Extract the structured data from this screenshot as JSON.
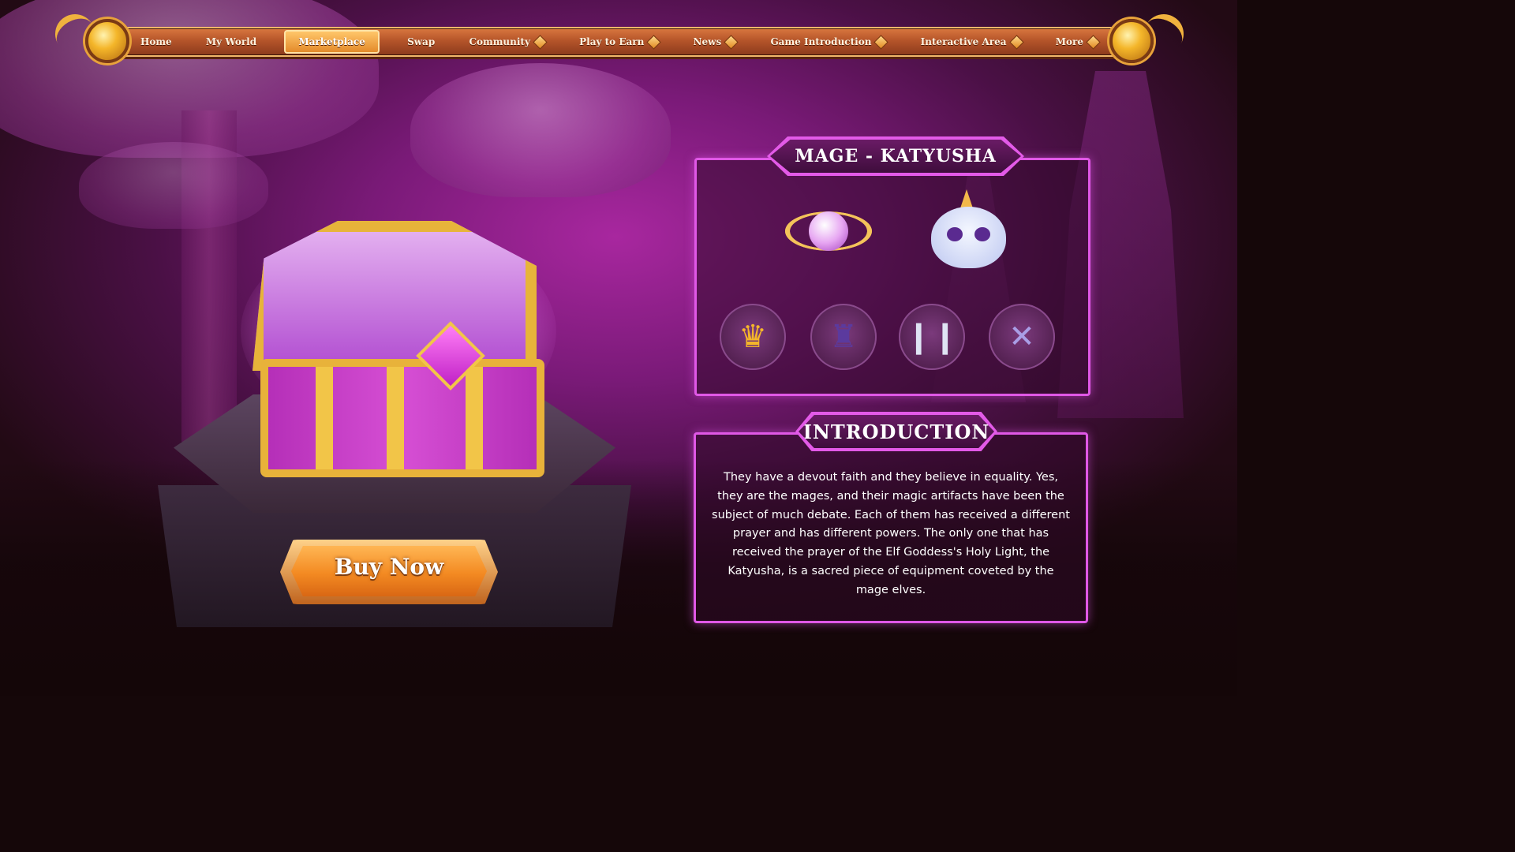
{
  "nav": {
    "items": [
      {
        "label": "Home",
        "active": false,
        "has_gem": false
      },
      {
        "label": "My World",
        "active": false,
        "has_gem": false
      },
      {
        "label": "Marketplace",
        "active": true,
        "has_gem": false
      },
      {
        "label": "Swap",
        "active": false,
        "has_gem": false
      },
      {
        "label": "Community",
        "active": false,
        "has_gem": true
      },
      {
        "label": "Play to Earn",
        "active": false,
        "has_gem": true
      },
      {
        "label": "News",
        "active": false,
        "has_gem": true
      },
      {
        "label": "Game Introduction",
        "active": false,
        "has_gem": true
      },
      {
        "label": "Interactive Area",
        "active": false,
        "has_gem": true
      },
      {
        "label": "More",
        "active": false,
        "has_gem": true
      }
    ]
  },
  "chest": {
    "buy_label": "Buy Now"
  },
  "set_panel": {
    "title": "MAGE - KATYUSHA",
    "items": [
      {
        "name": "orb-artifact-icon",
        "glyph": ""
      },
      {
        "name": "pet-icon",
        "glyph": ""
      },
      {
        "name": "crown-icon",
        "glyph": "♛"
      },
      {
        "name": "robe-icon",
        "glyph": "♜"
      },
      {
        "name": "boots-icon",
        "glyph": "❙❙"
      },
      {
        "name": "wings-icon",
        "glyph": "✕"
      }
    ]
  },
  "intro_panel": {
    "title": "INTRODUCTION",
    "text": "They have a devout faith and they believe in equality. Yes, they are the mages, and their magic artifacts have been the subject of much debate. Each of them has received a different prayer and has different powers. The only one that has received the prayer of the Elf Goddess's Holy Light, the Katyusha, is a sacred piece of equipment coveted by the mage elves."
  },
  "colors": {
    "accent_pink": "#e058e6",
    "nav_orange": "#b5552a",
    "button_orange": "#f38a22",
    "gold": "#e8b23a"
  }
}
